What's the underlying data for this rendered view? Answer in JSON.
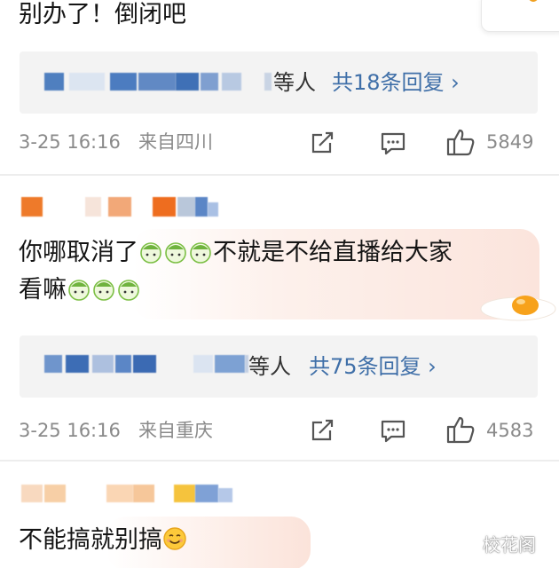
{
  "comments": [
    {
      "text": "别办了！倒闭吧",
      "replies": {
        "names_suffix": "等人",
        "link": "共18条回复 ›"
      },
      "meta": {
        "date": "3-25 16:16",
        "location": "来自四川"
      },
      "likes": "5849"
    },
    {
      "text_line1": "你哪取消了",
      "text_line1_after": "不就是不给直播给大家",
      "text_line2": "看嘛",
      "emoji": "grape-face",
      "replies": {
        "names_suffix": "等人",
        "link": "共75条回复 ›"
      },
      "meta": {
        "date": "3-25 16:16",
        "location": "来自重庆"
      },
      "likes": "4583"
    },
    {
      "text": "不能搞就别搞",
      "emoji": "smile"
    }
  ],
  "watermark": "校花阁",
  "colors": {
    "link": "#3f6fa8",
    "meta": "#8a8a8a",
    "reply_bg": "#f3f3f3"
  }
}
